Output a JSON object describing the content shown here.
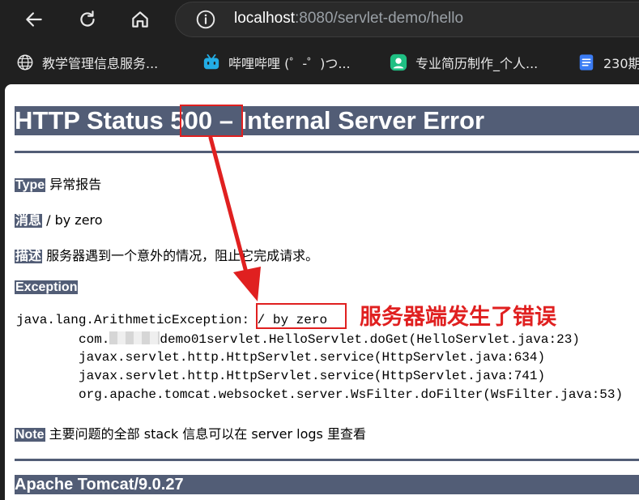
{
  "browser": {
    "url_host": "localhost",
    "url_rest": ":8080/servlet-demo/hello",
    "icons": [
      "back-arrow-icon",
      "reload-icon",
      "home-icon",
      "info-icon"
    ]
  },
  "bookmarks": [
    {
      "label": "教学管理信息服务...",
      "icon": "globe-icon"
    },
    {
      "label": "哔哩哔哩 (゜-゜)つ...",
      "icon": "bilibili-icon"
    },
    {
      "label": "专业简历制作_个人...",
      "icon": "resume-icon"
    },
    {
      "label": "230期",
      "icon": "doc-icon"
    }
  ],
  "page": {
    "title_prefix": "HTTP Status ",
    "title_code": "500",
    "title_suffix": " – Internal Server Error",
    "type_label": "Type",
    "type_value": "异常报告",
    "message_label": "消息",
    "message_value": "/ by zero",
    "desc_label": "描述",
    "desc_value": "服务器遇到一个意外的情况，阻止它完成请求。",
    "exception_label": "Exception",
    "exception_line": "java.lang.ArithmeticException:",
    "exception_message": "/ by zero",
    "stack_1_prefix": "com.",
    "stack_1_suffix": "demo01servlet.HelloServlet.doGet(HelloServlet.java:23)",
    "stack_2": "javax.servlet.http.HttpServlet.service(HttpServlet.java:634)",
    "stack_3": "javax.servlet.http.HttpServlet.service(HttpServlet.java:741)",
    "stack_4": "org.apache.tomcat.websocket.server.WsFilter.doFilter(WsFilter.java:53)",
    "note_label": "Note",
    "note_value": "主要问题的全部 stack 信息可以在 server logs 里查看",
    "footer": "Apache Tomcat/9.0.27"
  },
  "annotation": {
    "text": "服务器端发生了错误",
    "color": "#e02020"
  },
  "colors": {
    "tomcat_header": "#525d76",
    "browser_bg": "#202020"
  }
}
